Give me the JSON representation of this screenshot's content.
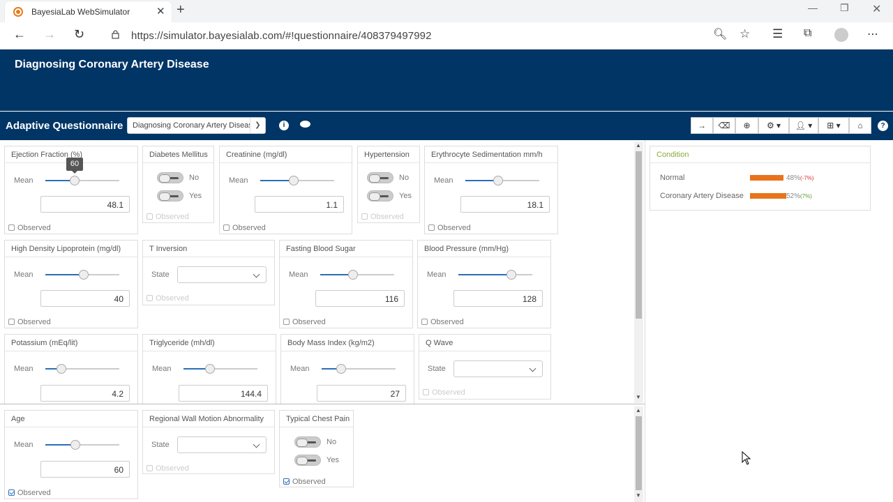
{
  "browser": {
    "tab_title": "BayesiaLab WebSimulator",
    "url": "https://simulator.bayesialab.com/#!questionnaire/408379497992"
  },
  "header": {
    "title": "Diagnosing Coronary Artery Disease"
  },
  "toolbar": {
    "label": "Adaptive Questionnaire",
    "network_select": "Diagnosing Coronary Artery Disease"
  },
  "common": {
    "mean": "Mean",
    "state": "State",
    "observed": "Observed",
    "no": "No",
    "yes": "Yes"
  },
  "tooltip": "60",
  "cards": {
    "ef": {
      "title": "Ejection Fraction (%)",
      "value": "48.1",
      "slider": 0.4
    },
    "dm": {
      "title": "Diabetes Mellitus"
    },
    "cr": {
      "title": "Creatinine (mg/dl)",
      "value": "1.1",
      "slider": 0.45
    },
    "ht": {
      "title": "Hypertension"
    },
    "esr": {
      "title": "Erythrocyte Sedimentation mm/h",
      "value": "18.1",
      "slider": 0.44
    },
    "hdl": {
      "title": "High Density Lipoprotein (mg/dl)",
      "value": "40",
      "slider": 0.52
    },
    "ti": {
      "title": "T Inversion"
    },
    "fbs": {
      "title": "Fasting Blood Sugar",
      "value": "116",
      "slider": 0.44
    },
    "bp": {
      "title": "Blood Pressure (mm/Hg)",
      "value": "128",
      "slider": 0.72
    },
    "k": {
      "title": "Potassium (mEq/lit)",
      "value": "4.2",
      "slider": 0.22
    },
    "tg": {
      "title": "Triglyceride (mh/dl)",
      "value": "144.4",
      "slider": 0.36
    },
    "bmi": {
      "title": "Body Mass Index (kg/m2)",
      "value": "27",
      "slider": 0.26
    },
    "qw": {
      "title": "Q Wave"
    },
    "age": {
      "title": "Age",
      "value": "60",
      "slider": 0.41
    },
    "rwma": {
      "title": "Regional Wall Motion Abnormality"
    },
    "tcp": {
      "title": "Typical Chest Pain"
    }
  },
  "condition": {
    "title": "Condition",
    "rows": [
      {
        "label": "Normal",
        "pct": "48%",
        "delta": "(-7%)",
        "fraction": 0.48
      },
      {
        "label": "Coronary Artery Disease",
        "pct": "52%",
        "delta": "(7%)",
        "fraction": 0.52
      }
    ]
  }
}
